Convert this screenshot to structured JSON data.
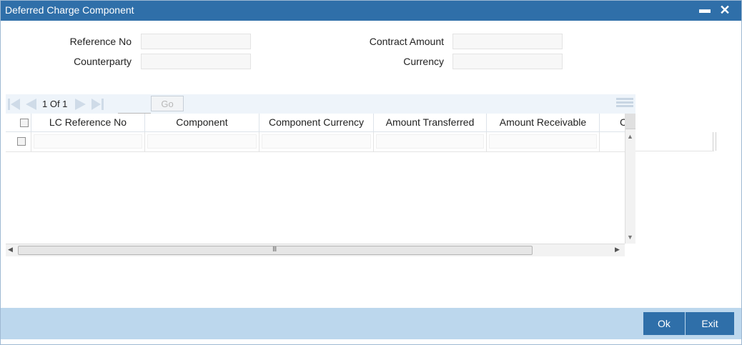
{
  "window": {
    "title": "Deferred Charge Component",
    "minimize_glyph": "▬",
    "close_glyph": "✕"
  },
  "form": {
    "reference_no_label": "Reference No",
    "reference_no_value": "",
    "counterparty_label": "Counterparty",
    "counterparty_value": "",
    "contract_amount_label": "Contract Amount",
    "contract_amount_value": "",
    "currency_label": "Currency",
    "currency_value": ""
  },
  "grid": {
    "pager_text": "1 Of 1",
    "page_input_value": "",
    "go_label": "Go",
    "columns": [
      "LC Reference No",
      "Component",
      "Component Currency",
      "Amount Transferred",
      "Amount Receivable",
      "C"
    ],
    "rows": [
      [
        "",
        "",
        "",
        "",
        "",
        ""
      ]
    ],
    "hscroll_grip": "III"
  },
  "footer": {
    "ok_label": "Ok",
    "exit_label": "Exit"
  },
  "colors": {
    "titlebar": "#2f6fa9",
    "footer_band": "#bcd7ed",
    "button": "#2f6fa9"
  },
  "icons": {
    "minimize": "minimize-icon",
    "close": "close-icon",
    "first_page": "first-page-icon",
    "prev_page": "previous-page-icon",
    "next_page": "next-page-icon",
    "last_page": "last-page-icon",
    "columns": "columns-icon"
  }
}
